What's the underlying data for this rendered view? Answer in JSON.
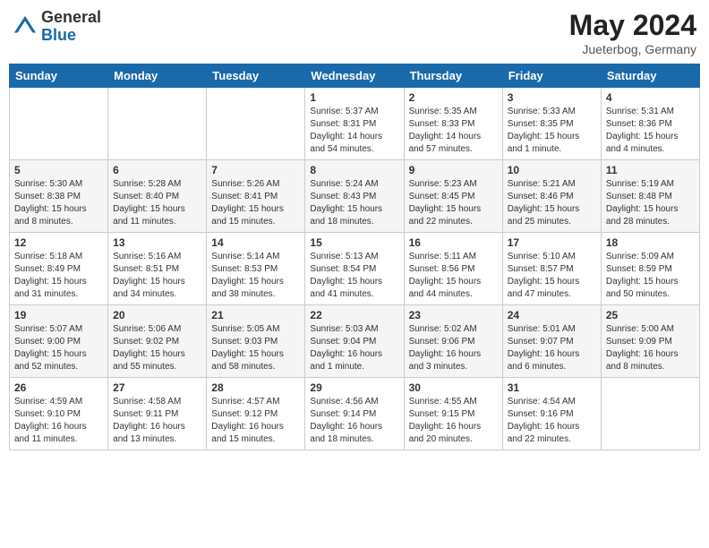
{
  "header": {
    "logo_general": "General",
    "logo_blue": "Blue",
    "month_year": "May 2024",
    "location": "Jueterbog, Germany"
  },
  "weekdays": [
    "Sunday",
    "Monday",
    "Tuesday",
    "Wednesday",
    "Thursday",
    "Friday",
    "Saturday"
  ],
  "weeks": [
    [
      {
        "day": "",
        "info": ""
      },
      {
        "day": "",
        "info": ""
      },
      {
        "day": "",
        "info": ""
      },
      {
        "day": "1",
        "info": "Sunrise: 5:37 AM\nSunset: 8:31 PM\nDaylight: 14 hours\nand 54 minutes."
      },
      {
        "day": "2",
        "info": "Sunrise: 5:35 AM\nSunset: 8:33 PM\nDaylight: 14 hours\nand 57 minutes."
      },
      {
        "day": "3",
        "info": "Sunrise: 5:33 AM\nSunset: 8:35 PM\nDaylight: 15 hours\nand 1 minute."
      },
      {
        "day": "4",
        "info": "Sunrise: 5:31 AM\nSunset: 8:36 PM\nDaylight: 15 hours\nand 4 minutes."
      }
    ],
    [
      {
        "day": "5",
        "info": "Sunrise: 5:30 AM\nSunset: 8:38 PM\nDaylight: 15 hours\nand 8 minutes."
      },
      {
        "day": "6",
        "info": "Sunrise: 5:28 AM\nSunset: 8:40 PM\nDaylight: 15 hours\nand 11 minutes."
      },
      {
        "day": "7",
        "info": "Sunrise: 5:26 AM\nSunset: 8:41 PM\nDaylight: 15 hours\nand 15 minutes."
      },
      {
        "day": "8",
        "info": "Sunrise: 5:24 AM\nSunset: 8:43 PM\nDaylight: 15 hours\nand 18 minutes."
      },
      {
        "day": "9",
        "info": "Sunrise: 5:23 AM\nSunset: 8:45 PM\nDaylight: 15 hours\nand 22 minutes."
      },
      {
        "day": "10",
        "info": "Sunrise: 5:21 AM\nSunset: 8:46 PM\nDaylight: 15 hours\nand 25 minutes."
      },
      {
        "day": "11",
        "info": "Sunrise: 5:19 AM\nSunset: 8:48 PM\nDaylight: 15 hours\nand 28 minutes."
      }
    ],
    [
      {
        "day": "12",
        "info": "Sunrise: 5:18 AM\nSunset: 8:49 PM\nDaylight: 15 hours\nand 31 minutes."
      },
      {
        "day": "13",
        "info": "Sunrise: 5:16 AM\nSunset: 8:51 PM\nDaylight: 15 hours\nand 34 minutes."
      },
      {
        "day": "14",
        "info": "Sunrise: 5:14 AM\nSunset: 8:53 PM\nDaylight: 15 hours\nand 38 minutes."
      },
      {
        "day": "15",
        "info": "Sunrise: 5:13 AM\nSunset: 8:54 PM\nDaylight: 15 hours\nand 41 minutes."
      },
      {
        "day": "16",
        "info": "Sunrise: 5:11 AM\nSunset: 8:56 PM\nDaylight: 15 hours\nand 44 minutes."
      },
      {
        "day": "17",
        "info": "Sunrise: 5:10 AM\nSunset: 8:57 PM\nDaylight: 15 hours\nand 47 minutes."
      },
      {
        "day": "18",
        "info": "Sunrise: 5:09 AM\nSunset: 8:59 PM\nDaylight: 15 hours\nand 50 minutes."
      }
    ],
    [
      {
        "day": "19",
        "info": "Sunrise: 5:07 AM\nSunset: 9:00 PM\nDaylight: 15 hours\nand 52 minutes."
      },
      {
        "day": "20",
        "info": "Sunrise: 5:06 AM\nSunset: 9:02 PM\nDaylight: 15 hours\nand 55 minutes."
      },
      {
        "day": "21",
        "info": "Sunrise: 5:05 AM\nSunset: 9:03 PM\nDaylight: 15 hours\nand 58 minutes."
      },
      {
        "day": "22",
        "info": "Sunrise: 5:03 AM\nSunset: 9:04 PM\nDaylight: 16 hours\nand 1 minute."
      },
      {
        "day": "23",
        "info": "Sunrise: 5:02 AM\nSunset: 9:06 PM\nDaylight: 16 hours\nand 3 minutes."
      },
      {
        "day": "24",
        "info": "Sunrise: 5:01 AM\nSunset: 9:07 PM\nDaylight: 16 hours\nand 6 minutes."
      },
      {
        "day": "25",
        "info": "Sunrise: 5:00 AM\nSunset: 9:09 PM\nDaylight: 16 hours\nand 8 minutes."
      }
    ],
    [
      {
        "day": "26",
        "info": "Sunrise: 4:59 AM\nSunset: 9:10 PM\nDaylight: 16 hours\nand 11 minutes."
      },
      {
        "day": "27",
        "info": "Sunrise: 4:58 AM\nSunset: 9:11 PM\nDaylight: 16 hours\nand 13 minutes."
      },
      {
        "day": "28",
        "info": "Sunrise: 4:57 AM\nSunset: 9:12 PM\nDaylight: 16 hours\nand 15 minutes."
      },
      {
        "day": "29",
        "info": "Sunrise: 4:56 AM\nSunset: 9:14 PM\nDaylight: 16 hours\nand 18 minutes."
      },
      {
        "day": "30",
        "info": "Sunrise: 4:55 AM\nSunset: 9:15 PM\nDaylight: 16 hours\nand 20 minutes."
      },
      {
        "day": "31",
        "info": "Sunrise: 4:54 AM\nSunset: 9:16 PM\nDaylight: 16 hours\nand 22 minutes."
      },
      {
        "day": "",
        "info": ""
      }
    ]
  ]
}
